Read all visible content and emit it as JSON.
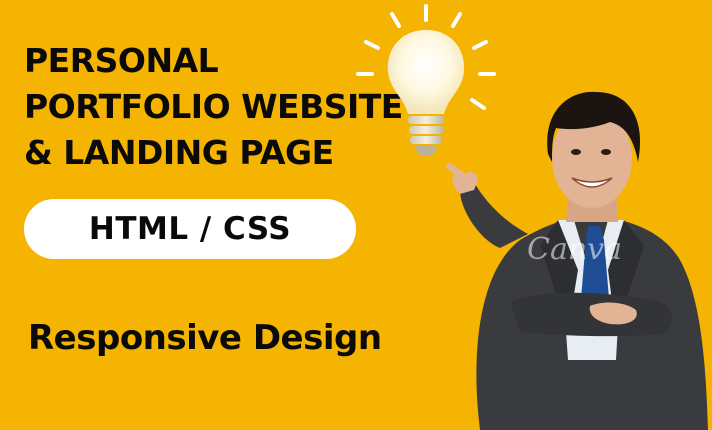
{
  "headline": {
    "line1": "PERSONAL",
    "line2": "PORTFOLIO WEBSITE",
    "line3": "& LANDING PAGE"
  },
  "pill": {
    "label": "HTML / CSS"
  },
  "subtitle": "Responsive Design",
  "watermark": "Canva",
  "colors": {
    "background": "#f5b402",
    "text": "#0a0a0a",
    "pill": "#ffffff"
  },
  "icons": {
    "bulb": "light-bulb-icon"
  }
}
